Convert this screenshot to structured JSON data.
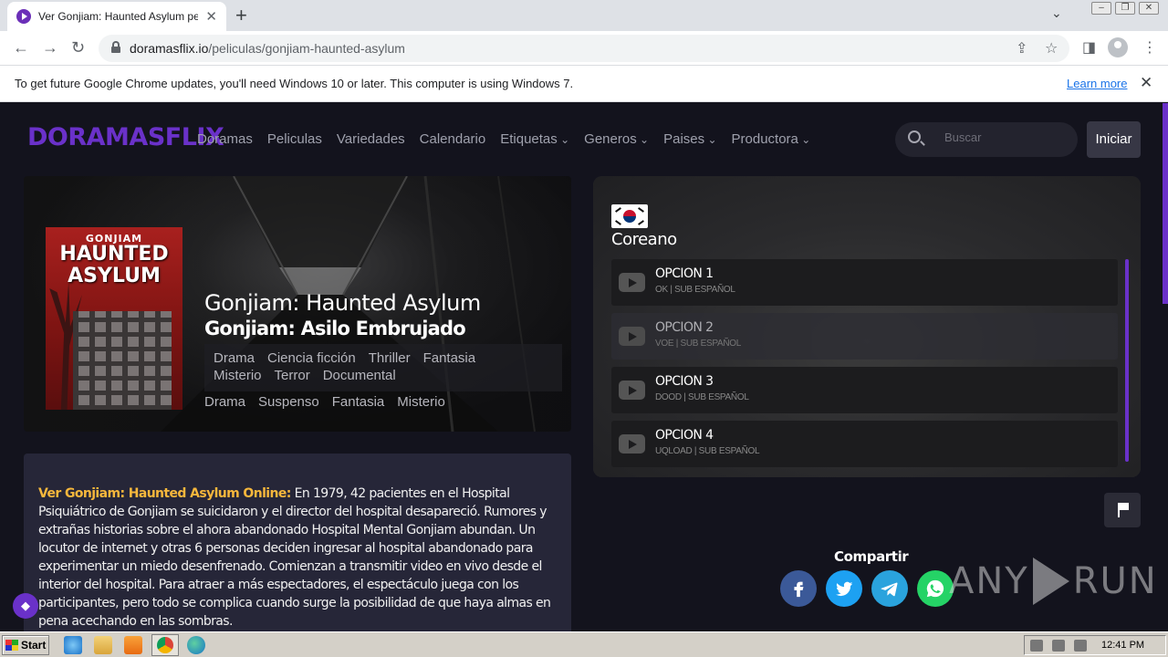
{
  "browser": {
    "tab_title": "Ver Gonjiam: Haunted Asylum pelicula",
    "url_host": "doramasflix.io",
    "url_path": "/peliculas/gonjiam-haunted-asylum",
    "infobar_text": "To get future Google Chrome updates, you'll need Windows 10 or later. This computer is using Windows 7.",
    "infobar_link": "Learn more"
  },
  "site": {
    "logo": "DORAMASFLIX",
    "nav": [
      "Doramas",
      "Peliculas",
      "Variedades",
      "Calendario",
      "Etiquetas",
      "Generos",
      "Paises",
      "Productora"
    ],
    "search_placeholder": "Buscar",
    "login_label": "Iniciar"
  },
  "movie": {
    "poster_line1": "GONJIAM",
    "poster_line2": "HAUNTED ASYLUM",
    "title": "Gonjiam: Haunted Asylum",
    "subtitle": "Gonjiam: Asilo Embrujado",
    "genres": [
      "Drama",
      "Ciencia ficción",
      "Thriller",
      "Fantasia",
      "Misterio",
      "Terror",
      "Documental"
    ],
    "tags": [
      "Drama",
      "Suspenso",
      "Fantasia",
      "Misterio"
    ],
    "synopsis_lead": "Ver Gonjiam: Haunted Asylum Online:",
    "synopsis": "En 1979, 42 pacientes en el Hospital Psiquiátrico de Gonjiam se suicidaron y el director del hospital desapareció. Rumores y extrañas historias sobre el ahora abandonado Hospital Mental Gonjiam abundan. Un locutor de internet y otras 6 personas deciden ingresar al hospital abandonado para experimentar un miedo desenfrenado. Comienzan a transmitir video en vivo desde el interior del hospital. Para atraer a más espectadores, el espectáculo juega con los participantes, pero todo se complica cuando surge la posibilidad de que haya almas en pena acechando en las sombras."
  },
  "player": {
    "language": "Coreano",
    "options": [
      {
        "name": "OPCION 1",
        "meta": "OK | SUB ESPAÑOL"
      },
      {
        "name": "OPCION 2",
        "meta": "VOE | SUB ESPAÑOL"
      },
      {
        "name": "OPCION 3",
        "meta": "DOOD | SUB ESPAÑOL"
      },
      {
        "name": "OPCION 4",
        "meta": "UQLOAD | SUB ESPAÑOL"
      }
    ]
  },
  "share": {
    "title": "Compartir",
    "networks": [
      "facebook",
      "twitter",
      "telegram",
      "whatsapp"
    ],
    "colors": {
      "facebook": "#3b5998",
      "twitter": "#1da1f2",
      "telegram": "#2aa3dd",
      "whatsapp": "#25d366"
    }
  },
  "watermark": {
    "left": "ANY",
    "right": "RUN"
  },
  "taskbar": {
    "start_label": "Start",
    "clock": "12:41 PM"
  },
  "colors": {
    "accent": "#6a31c9",
    "highlight": "#f6b73c"
  }
}
